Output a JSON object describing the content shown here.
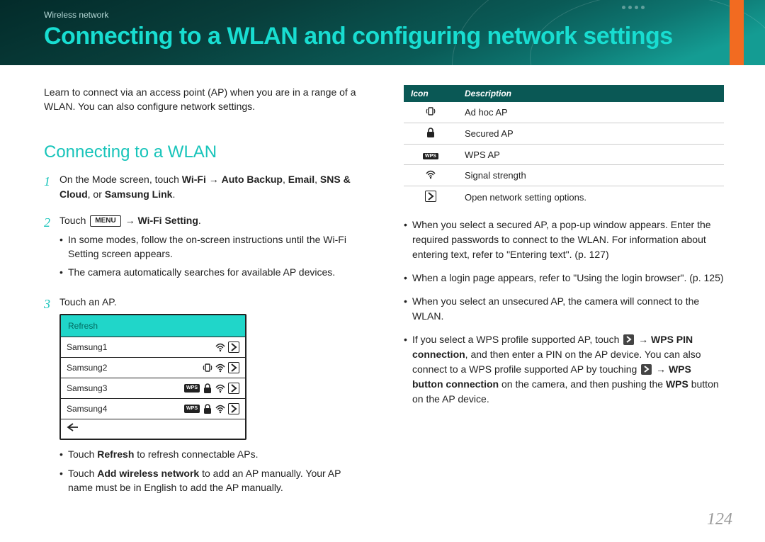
{
  "header": {
    "breadcrumb": "Wireless network",
    "title": "Connecting to a WLAN and configuring network settings"
  },
  "left": {
    "intro": "Learn to connect via an access point (AP) when you are in a range of a WLAN. You can also configure network settings.",
    "section_title": "Connecting to a WLAN",
    "step1_pre": "On the Mode screen, touch ",
    "step1_b1": "Wi-Fi",
    "step1_arrow": " → ",
    "step1_b2": "Auto Backup",
    "step1_c1": ", ",
    "step1_b3": "Email",
    "step1_c2": ", ",
    "step1_b4": "SNS & Cloud",
    "step1_c3": ", or ",
    "step1_b5": "Samsung Link",
    "step1_end": ".",
    "step2_pre": "Touch ",
    "step2_menu": "MENU",
    "step2_arrow": " → ",
    "step2_b1": "Wi-Fi Setting",
    "step2_end": ".",
    "step2_sub1": "In some modes, follow the on-screen instructions until the Wi-Fi Setting screen appears.",
    "step2_sub2": "The camera automatically searches for available AP devices.",
    "step3": "Touch an AP.",
    "ap": {
      "refresh": "Refresh",
      "row1": "Samsung1",
      "row2": "Samsung2",
      "row3": "Samsung3",
      "row4": "Samsung4"
    },
    "step3_sub1_pre": "Touch ",
    "step3_sub1_b": "Refresh",
    "step3_sub1_post": " to refresh connectable APs.",
    "step3_sub2_pre": "Touch ",
    "step3_sub2_b": "Add wireless network",
    "step3_sub2_post": " to add an AP manually. Your AP name must be in English to add the AP manually."
  },
  "right": {
    "table_h1": "Icon",
    "table_h2": "Description",
    "r1": "Ad hoc AP",
    "r2": "Secured AP",
    "r3": "WPS AP",
    "r4": "Signal strength",
    "r5": "Open network setting options.",
    "b1": "When you select a secured AP, a pop-up window appears. Enter the required passwords to connect to the WLAN. For information about entering text, refer to \"Entering text\". (p. 127)",
    "b2": "When a login page appears, refer to \"Using the login browser\". (p. 125)",
    "b3": "When you select an unsecured AP, the camera will connect to the WLAN.",
    "b4_pre": "If you select a WPS profile supported AP, touch ",
    "b4_arrow1": " → ",
    "b4_b1": "WPS PIN connection",
    "b4_mid": ", and then enter a PIN on the AP device. You can also connect to a WPS profile supported AP by touching ",
    "b4_arrow2": " → ",
    "b4_b2": "WPS button connection",
    "b4_mid2": " on the camera, and then pushing the ",
    "b4_b3": "WPS",
    "b4_end": " button on the AP device."
  },
  "page_number": "124"
}
